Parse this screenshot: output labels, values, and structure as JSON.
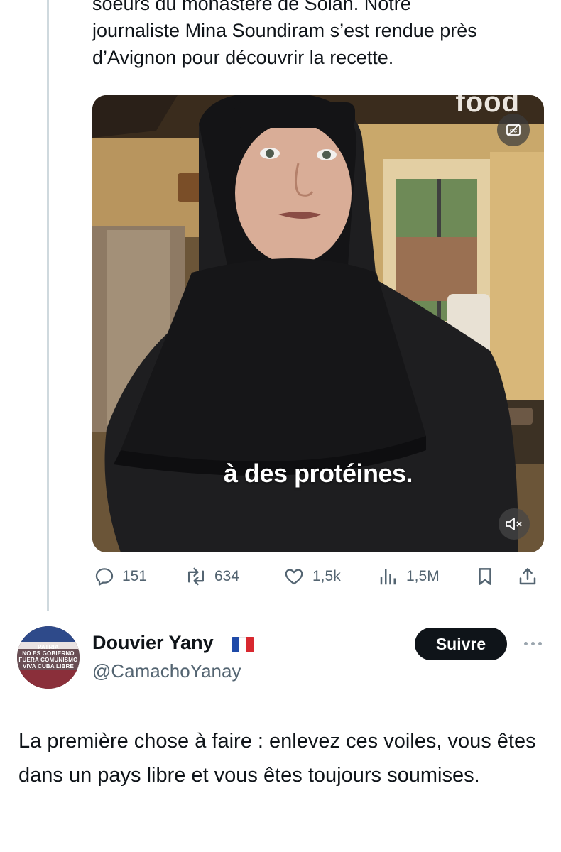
{
  "post": {
    "text_lines": [
      "soeurs du monastère de Solan. Notre",
      "journaliste Mina Soundiram s’est rendue près",
      "d’Avignon pour découvrir la recette."
    ],
    "media": {
      "watermark": "food",
      "subtitle": "à des protéines.",
      "cc_icon": "closed-captions-icon",
      "mute_icon": "speaker-muted-icon"
    },
    "actions": {
      "replies": "151",
      "reposts": "634",
      "likes": "1,5k",
      "views": "1,5M"
    }
  },
  "reply": {
    "avatar_lines": [
      "PATRIA",
      "NO ES GOBIERNO",
      "FUERA COMUNISMO",
      "VIVA CUBA LIBRE"
    ],
    "author_name": "Douvier Yany",
    "flag": "french-flag-icon",
    "handle": "@CamachoYanay",
    "follow_label": "Suivre",
    "text": "La première chose à faire : enlevez ces voiles, vous êtes dans un pays libre et vous êtes toujours soumises."
  },
  "colors": {
    "text": "#0f1419",
    "secondary": "#536471",
    "thread_line": "#cfd9de",
    "follow_bg": "#0f1419"
  }
}
